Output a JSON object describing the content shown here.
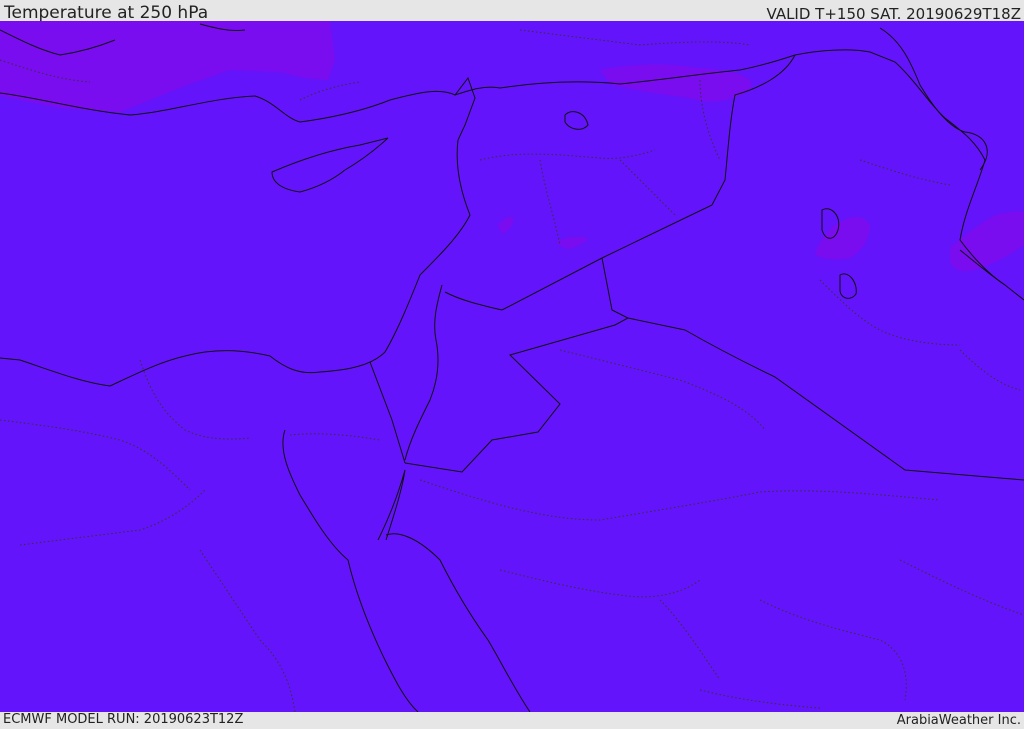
{
  "header": {
    "title": "Temperature at 250 hPa",
    "valid": "VALID T+150 SAT. 20190629T18Z"
  },
  "footer": {
    "model_run": "ECMWF MODEL RUN: 20190623T12Z",
    "credit": "ArabiaWeather Inc."
  },
  "map": {
    "region": "Eastern Mediterranean, Levant, Egypt, Arabian Peninsula, Iraq",
    "field": "temperature",
    "colors": {
      "background": "#6414fa",
      "warmer_patches": "#7a0cf0",
      "coastline": "#111111",
      "border": "#111111",
      "internal_border": "#333333"
    }
  }
}
